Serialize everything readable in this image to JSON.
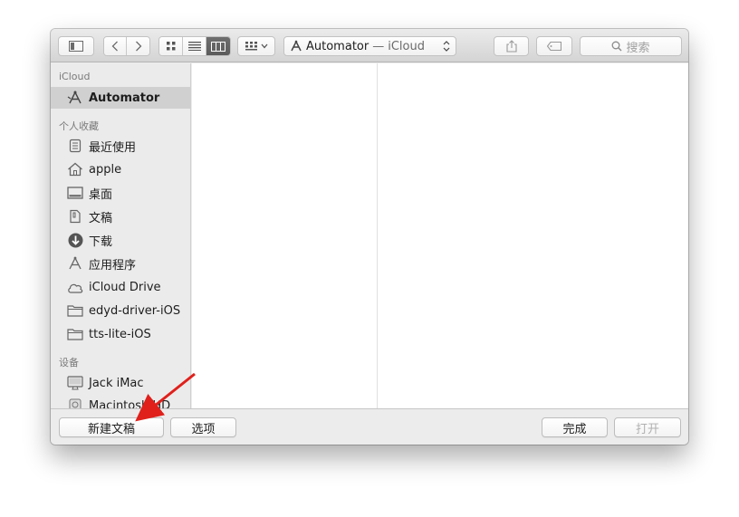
{
  "toolbar": {
    "path_popup": {
      "name": "Automator",
      "separator": "—",
      "location": "iCloud"
    },
    "search_placeholder": "搜索"
  },
  "sidebar": {
    "sections": [
      {
        "title": "iCloud",
        "items": [
          {
            "label": "Automator",
            "icon": "automator-icon",
            "selected": true
          }
        ]
      },
      {
        "title": "个人收藏",
        "items": [
          {
            "label": "最近使用",
            "icon": "recents-icon"
          },
          {
            "label": "apple",
            "icon": "home-icon"
          },
          {
            "label": "桌面",
            "icon": "desktop-icon"
          },
          {
            "label": "文稿",
            "icon": "documents-icon"
          },
          {
            "label": "下载",
            "icon": "downloads-icon"
          },
          {
            "label": "应用程序",
            "icon": "applications-icon"
          },
          {
            "label": "iCloud Drive",
            "icon": "cloud-icon"
          },
          {
            "label": "edyd-driver-iOS",
            "icon": "folder-icon"
          },
          {
            "label": "tts-lite-iOS",
            "icon": "folder-icon"
          }
        ]
      },
      {
        "title": "设备",
        "items": [
          {
            "label": "Jack iMac",
            "icon": "imac-icon"
          },
          {
            "label": "Macintosh HD",
            "icon": "disk-icon"
          }
        ]
      }
    ]
  },
  "bottom": {
    "new_document": "新建文稿",
    "options": "选项",
    "done": "完成",
    "open": "打开"
  },
  "colors": {
    "arrow": "#e0201b",
    "selection": "#d0d0d0"
  }
}
